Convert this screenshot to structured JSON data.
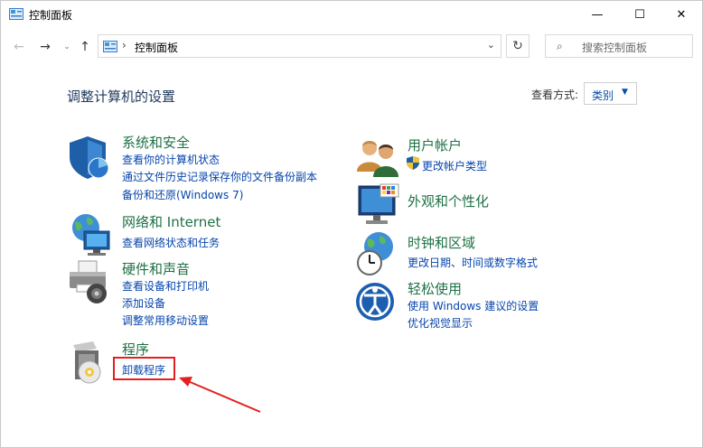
{
  "window": {
    "title": "控制面板",
    "controls": {
      "minimize": "—",
      "maximize": "☐",
      "close": "✕"
    }
  },
  "address_bar": {
    "separator": "›",
    "path": "控制面板",
    "search_placeholder": "搜索控制面板"
  },
  "main": {
    "heading": "调整计算机的设置",
    "view_by_label": "查看方式:",
    "view_by_value": "类别"
  },
  "categories": {
    "system": {
      "title": "系统和安全",
      "links": [
        "查看你的计算机状态",
        "通过文件历史记录保存你的文件备份副本",
        "备份和还原(Windows 7)"
      ]
    },
    "network": {
      "title": "网络和 Internet",
      "links": [
        "查看网络状态和任务"
      ]
    },
    "hardware": {
      "title": "硬件和声音",
      "links": [
        "查看设备和打印机",
        "添加设备",
        "调整常用移动设置"
      ]
    },
    "programs": {
      "title": "程序",
      "links": [
        "卸载程序"
      ]
    },
    "user": {
      "title": "用户帐户",
      "links": [
        "更改帐户类型"
      ]
    },
    "appearance": {
      "title": "外观和个性化",
      "links": []
    },
    "clock": {
      "title": "时钟和区域",
      "links": [
        "更改日期、时间或数字格式"
      ]
    },
    "ease": {
      "title": "轻松使用",
      "links": [
        "使用 Windows 建议的设置",
        "优化视觉显示"
      ]
    }
  },
  "colors": {
    "category_title": "#1e7145",
    "link": "#0645ad",
    "annotation": "#e51f1f"
  }
}
